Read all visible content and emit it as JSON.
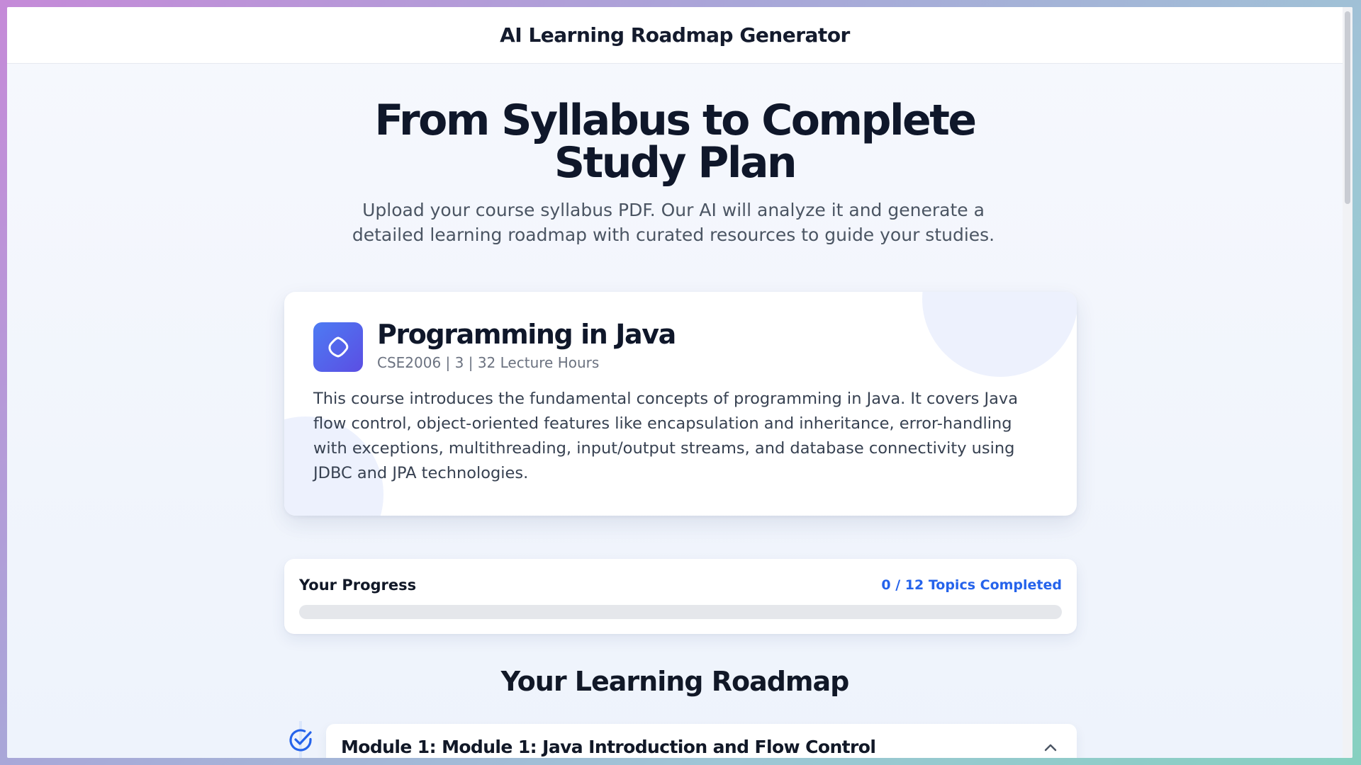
{
  "app": {
    "title": "AI Learning Roadmap Generator"
  },
  "hero": {
    "title_line1": "From Syllabus to Complete",
    "title_line2": "Study Plan",
    "subtitle_line1": "Upload your course syllabus PDF. Our AI will analyze it and generate a",
    "subtitle_line2": "detailed learning roadmap with curated resources to guide your studies."
  },
  "course": {
    "icon": "java-icon",
    "title": "Programming in Java",
    "meta": "CSE2006 | 3 | 32 Lecture Hours",
    "description": "This course introduces the fundamental concepts of programming in Java. It covers Java flow control, object-oriented features like encapsulation and inheritance, error-handling with exceptions, multithreading, input/output streams, and database connectivity using JDBC and JPA technologies."
  },
  "progress": {
    "label": "Your Progress",
    "count_text": "0 / 12 Topics Completed",
    "completed_fraction": 0
  },
  "roadmap": {
    "title": "Your Learning Roadmap",
    "modules": [
      {
        "title": "Module 1: Module 1: Java Introduction and Flow Control",
        "status_icon": "check-circle-icon",
        "expanded": true
      }
    ]
  },
  "colors": {
    "accent": "#2563eb",
    "icon_gradient_start": "#4d7bf3",
    "icon_gradient_end": "#5b4ee3"
  }
}
